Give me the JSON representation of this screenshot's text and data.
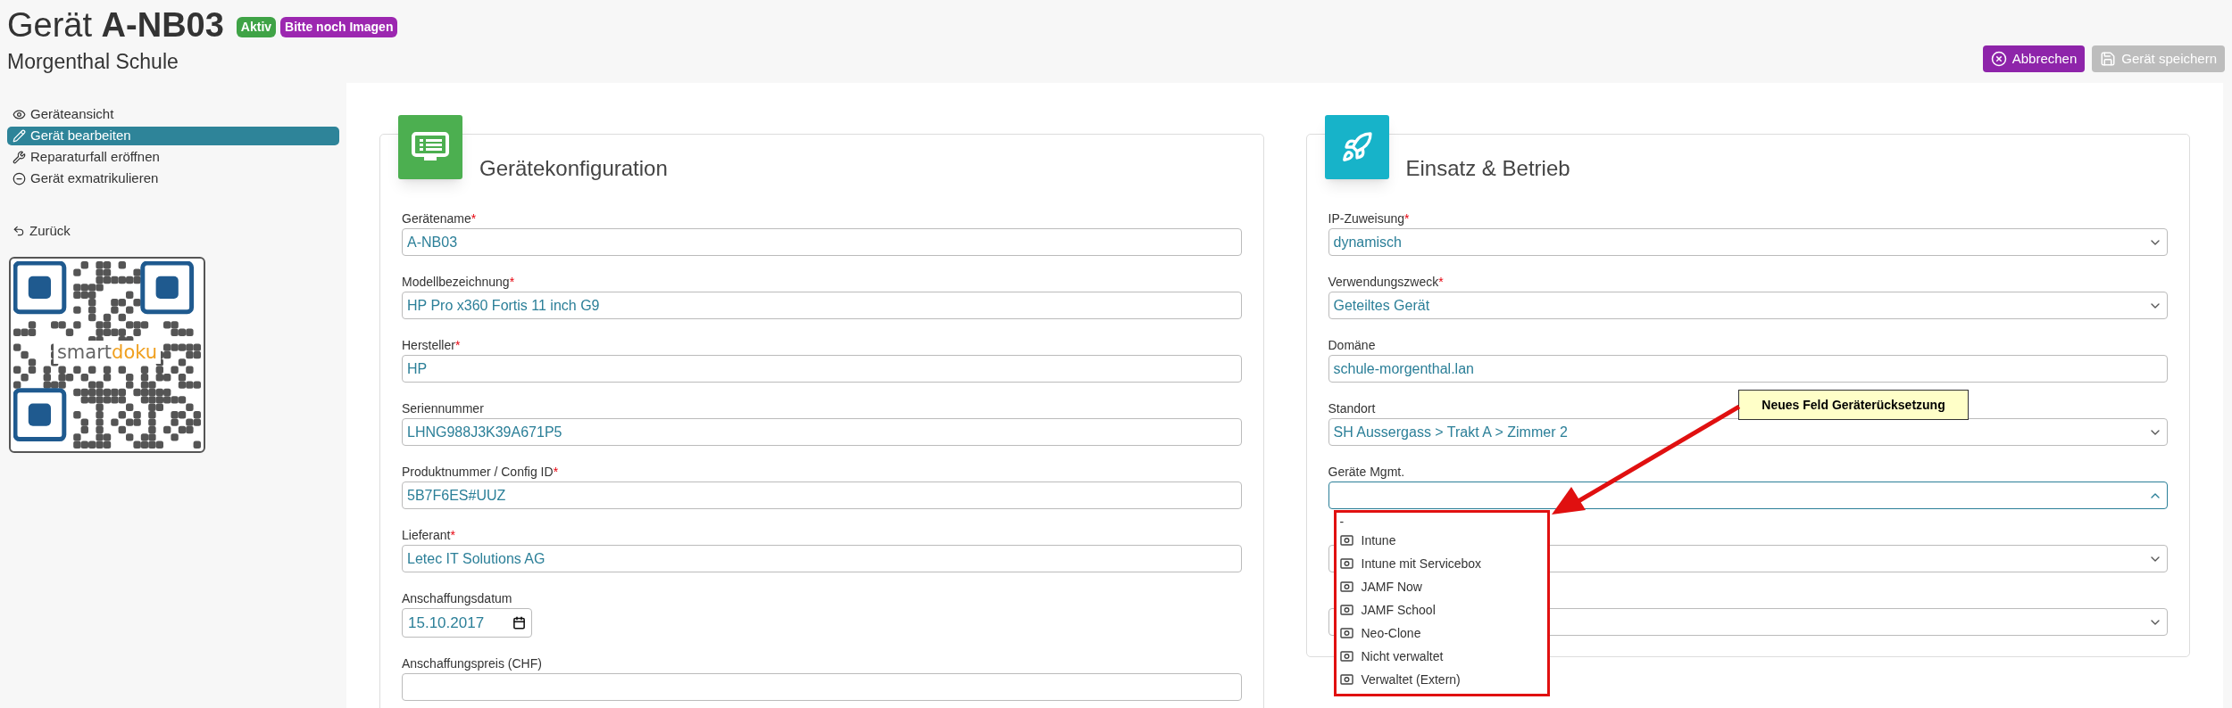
{
  "header": {
    "title_prefix": "Gerät",
    "title_name": "A-NB03",
    "badges": [
      {
        "label": "Aktiv",
        "color": "#3fa346"
      },
      {
        "label": "Bitte noch Imagen",
        "color": "#9c27b0"
      }
    ],
    "subtitle": "Morgenthal Schule"
  },
  "actions": [
    {
      "label": "Abbrechen",
      "kind": "cancel",
      "disabled": false
    },
    {
      "label": "Gerät speichern",
      "kind": "save",
      "disabled": true
    }
  ],
  "sidebar": {
    "items": [
      {
        "label": "Geräteansicht",
        "kind": "view",
        "selected": false
      },
      {
        "label": "Gerät bearbeiten",
        "kind": "edit",
        "selected": true
      },
      {
        "label": "Reparaturfall eröffnen",
        "kind": "repair",
        "selected": false
      },
      {
        "label": "Gerät exmatrikulieren",
        "kind": "remove",
        "selected": false
      }
    ],
    "back": "Zurück",
    "qr_logo": [
      "smart",
      "doku"
    ]
  },
  "cards": [
    {
      "title": "Gerätekonfiguration",
      "kind": "config",
      "fields": [
        {
          "label": "Gerätename",
          "required_mark": "*",
          "kind": "text",
          "value": "A-NB03"
        },
        {
          "label": "Modellbezeichnung",
          "required_mark": "*",
          "kind": "text",
          "value": "HP Pro x360 Fortis 11 inch G9"
        },
        {
          "label": "Hersteller",
          "required_mark": "*",
          "kind": "text",
          "value": "HP"
        },
        {
          "label": "Seriennummer",
          "kind": "text",
          "value": "LHNG988J3K39A671P5"
        },
        {
          "label": "Produktnummer / Config ID",
          "required_mark": "*",
          "kind": "text",
          "value": "5B7F6ES#UUZ"
        },
        {
          "label": "Lieferant",
          "required_mark": "*",
          "kind": "text",
          "value": "Letec IT Solutions AG"
        },
        {
          "label": "Anschaffungsdatum",
          "kind": "date",
          "value": "15.10.2017"
        },
        {
          "label": "Anschaffungspreis (CHF)",
          "kind": "text"
        }
      ]
    },
    {
      "title": "Einsatz & Betrieb",
      "kind": "deploy",
      "fields": [
        {
          "label": "IP-Zuweisung",
          "required_mark": "*",
          "kind": "select",
          "expanded": false,
          "value": "dynamisch"
        },
        {
          "label": "Verwendungszweck",
          "required_mark": "*",
          "kind": "select",
          "expanded": false,
          "value": "Geteiltes Gerät"
        },
        {
          "label": "Domäne",
          "kind": "text",
          "value": "schule-morgenthal.lan"
        },
        {
          "label": "Standort",
          "kind": "select",
          "expanded": false,
          "value": "SH Aussergass > Trakt A > Zimmer 2"
        },
        {
          "label": "Geräte Mgmt.",
          "kind": "select",
          "expanded": true,
          "options": [
            {
              "label": "-",
              "kind": "blank"
            },
            {
              "label": "Intune",
              "kind": "option"
            },
            {
              "label": "Intune mit Servicebox",
              "kind": "option"
            },
            {
              "label": "JAMF Now",
              "kind": "option"
            },
            {
              "label": "JAMF School",
              "kind": "option"
            },
            {
              "label": "Neo-Clone",
              "kind": "option"
            },
            {
              "label": "Nicht verwaltet",
              "kind": "option"
            },
            {
              "label": "Verwaltet (Extern)",
              "kind": "option"
            }
          ]
        },
        {
          "kind": "select",
          "expanded": false
        },
        {
          "kind": "select",
          "expanded": false
        }
      ]
    }
  ],
  "annotation": {
    "note": "Neues Feld Geräterücksetzung"
  }
}
